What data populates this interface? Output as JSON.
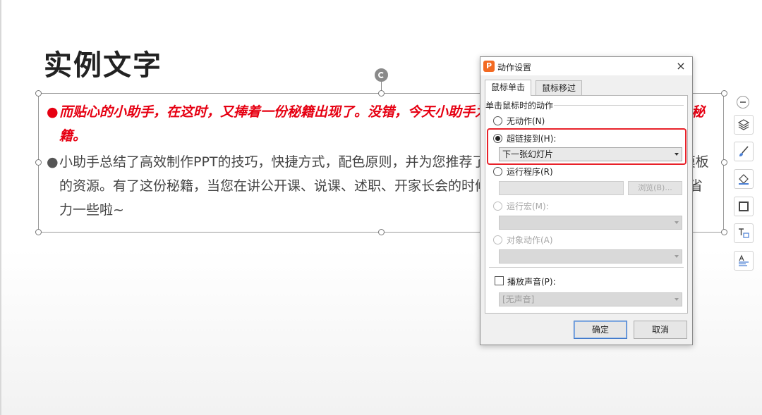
{
  "slide": {
    "title": "实例文字",
    "paragraphs": [
      {
        "bullet": "●",
        "text": "而贴心的小助手，在这时，又捧着一份秘籍出现了。没错，今天小助手为您带来的就是职场人士必备的PPT秘籍。"
      },
      {
        "bullet": "●",
        "text": "小助手总结了高效制作PPT的技巧，快捷方式，配色原则，并为您推荐了精选的PPT学习网站以及免费PPT模板的资源。有了这份秘籍，当您在讲公开课、说课、述职、开家长会的时候，相信一定能够让您的工作更省时省力一些啦~"
      }
    ],
    "colors": {
      "bullet1": "#e60012",
      "bullet2": "#444444"
    }
  },
  "sidebar_tools": [
    "collapse-icon",
    "layers-icon",
    "brush-icon",
    "fill-icon",
    "border-icon",
    "textbox-icon",
    "text-style-icon"
  ],
  "dialog": {
    "app_icon": "P",
    "title": "动作设置",
    "close": "×",
    "tabs": [
      {
        "label": "鼠标单击",
        "active": true
      },
      {
        "label": "鼠标移过",
        "active": false
      }
    ],
    "group_label": "单击鼠标时的动作",
    "options": {
      "none": {
        "label": "无动作(N)",
        "checked": false,
        "enabled": true
      },
      "hyperlink": {
        "label": "超链接到(H):",
        "checked": true,
        "enabled": true,
        "value": "下一张幻灯片"
      },
      "run_program": {
        "label": "运行程序(R)",
        "checked": false,
        "enabled": true,
        "browse_label": "浏览(B)..."
      },
      "run_macro": {
        "label": "运行宏(M):",
        "checked": false,
        "enabled": false
      },
      "object_action": {
        "label": "对象动作(A)",
        "checked": false,
        "enabled": false
      }
    },
    "play_sound": {
      "label": "播放声音(P):",
      "checked": false,
      "value": "[无声音]"
    },
    "ok_label": "确定",
    "cancel_label": "取消",
    "highlight_color": "#e8222a"
  }
}
